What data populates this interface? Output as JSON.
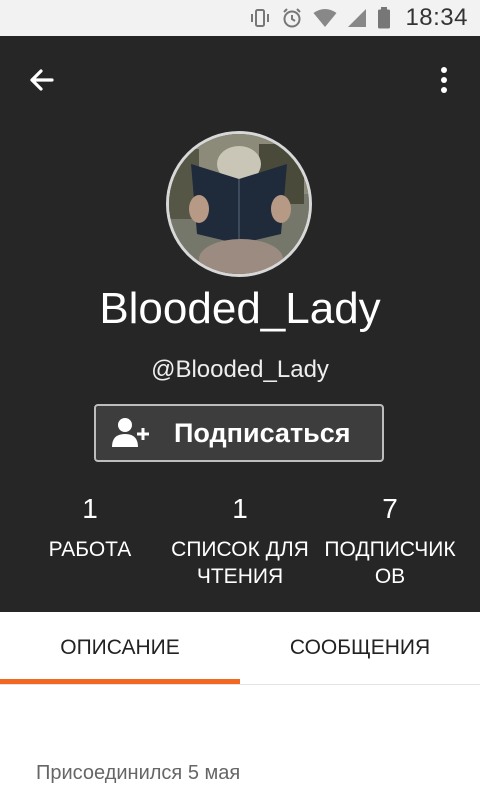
{
  "status_bar": {
    "time": "18:34",
    "icons": [
      "vibrate-icon",
      "alarm-icon",
      "wifi-icon",
      "signal-icon",
      "battery-icon"
    ]
  },
  "header": {
    "back_icon": "arrow-left-icon",
    "menu_icon": "more-vertical-icon",
    "background_color": "#262626"
  },
  "profile": {
    "display_name": "Blooded_Lady",
    "handle": "@Blooded_Lady",
    "avatar_icon": "avatar-image",
    "follow_button": {
      "label": "Подписаться",
      "icon": "add-person-icon"
    }
  },
  "stats": [
    {
      "value": "1",
      "label_lines": [
        "РАБОТА"
      ]
    },
    {
      "value": "1",
      "label_lines": [
        "СПИСОК ДЛЯ",
        "ЧТЕНИЯ"
      ]
    },
    {
      "value": "7",
      "label_lines": [
        "ПОДПИСЧИК",
        "ОВ"
      ]
    }
  ],
  "tabs": [
    {
      "label": "ОПИСАНИЕ",
      "active": true
    },
    {
      "label": "СООБЩЕНИЯ",
      "active": false
    }
  ],
  "accent_color": "#f26722",
  "about": {
    "joined_text": "Присоединился 5 мая"
  }
}
